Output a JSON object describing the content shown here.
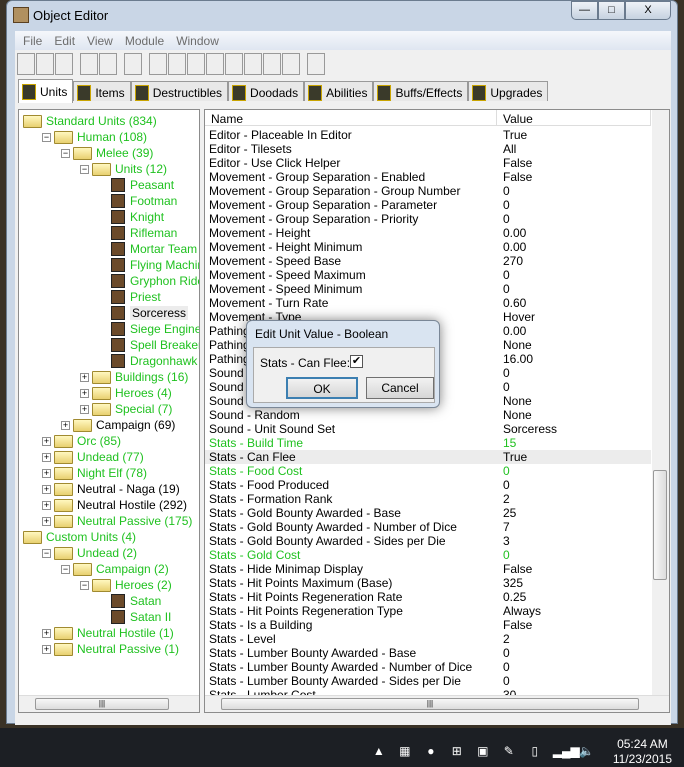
{
  "window": {
    "title": "Object Editor",
    "min": "—",
    "max": "□",
    "close": "X"
  },
  "menu": [
    "File",
    "Edit",
    "View",
    "Module",
    "Window"
  ],
  "toolbar": [
    "new",
    "open",
    "save",
    "copy",
    "paste",
    "unit",
    "terrain",
    "text",
    "sound",
    "unit-editor",
    "item",
    "destructible",
    "doodad",
    "import",
    "checklist"
  ],
  "tabs": [
    {
      "label": "Units",
      "active": true
    },
    {
      "label": "Items"
    },
    {
      "label": "Destructibles"
    },
    {
      "label": "Doodads"
    },
    {
      "label": "Abilities"
    },
    {
      "label": "Buffs/Effects"
    },
    {
      "label": "Upgrades"
    }
  ],
  "tree": [
    {
      "label": "Standard Units (834)",
      "level": 0,
      "type": "folder-open",
      "exp": ""
    },
    {
      "label": "Human (108)",
      "level": 1,
      "type": "folder-open",
      "exp": "-"
    },
    {
      "label": "Melee (39)",
      "level": 2,
      "type": "folder-open",
      "exp": "-"
    },
    {
      "label": "Units (12)",
      "level": 3,
      "type": "folder-open",
      "exp": "-"
    },
    {
      "label": "Peasant",
      "level": 4,
      "type": "unit"
    },
    {
      "label": "Footman",
      "level": 4,
      "type": "unit"
    },
    {
      "label": "Knight",
      "level": 4,
      "type": "unit"
    },
    {
      "label": "Rifleman",
      "level": 4,
      "type": "unit"
    },
    {
      "label": "Mortar Team",
      "level": 4,
      "type": "unit"
    },
    {
      "label": "Flying Machine",
      "level": 4,
      "type": "unit"
    },
    {
      "label": "Gryphon Rider",
      "level": 4,
      "type": "unit"
    },
    {
      "label": "Priest",
      "level": 4,
      "type": "unit"
    },
    {
      "label": "Sorceress",
      "level": 4,
      "type": "unit",
      "selected": true
    },
    {
      "label": "Siege Engine",
      "level": 4,
      "type": "unit"
    },
    {
      "label": "Spell Breaker",
      "level": 4,
      "type": "unit"
    },
    {
      "label": "Dragonhawk Rider",
      "level": 4,
      "type": "unit"
    },
    {
      "label": "Buildings (16)",
      "level": 3,
      "type": "folder",
      "exp": "+"
    },
    {
      "label": "Heroes (4)",
      "level": 3,
      "type": "folder",
      "exp": "+"
    },
    {
      "label": "Special (7)",
      "level": 3,
      "type": "folder",
      "exp": "+"
    },
    {
      "label": "Campaign (69)",
      "level": 2,
      "type": "folder",
      "exp": "+",
      "black": true
    },
    {
      "label": "Orc (85)",
      "level": 1,
      "type": "folder",
      "exp": "+"
    },
    {
      "label": "Undead (77)",
      "level": 1,
      "type": "folder",
      "exp": "+"
    },
    {
      "label": "Night Elf (78)",
      "level": 1,
      "type": "folder",
      "exp": "+"
    },
    {
      "label": "Neutral - Naga (19)",
      "level": 1,
      "type": "folder",
      "exp": "+",
      "black": true
    },
    {
      "label": "Neutral Hostile (292)",
      "level": 1,
      "type": "folder",
      "exp": "+",
      "black": true
    },
    {
      "label": "Neutral Passive (175)",
      "level": 1,
      "type": "folder",
      "exp": "+"
    },
    {
      "label": "Custom Units (4)",
      "level": 0,
      "type": "folder-open",
      "exp": ""
    },
    {
      "label": "Undead (2)",
      "level": 1,
      "type": "folder-open",
      "exp": "-"
    },
    {
      "label": "Campaign (2)",
      "level": 2,
      "type": "folder-open",
      "exp": "-"
    },
    {
      "label": "Heroes (2)",
      "level": 3,
      "type": "folder-open",
      "exp": "-"
    },
    {
      "label": "Satan",
      "level": 4,
      "type": "unit"
    },
    {
      "label": "Satan II",
      "level": 4,
      "type": "unit"
    },
    {
      "label": "Neutral Hostile (1)",
      "level": 1,
      "type": "folder",
      "exp": "+"
    },
    {
      "label": "Neutral Passive (1)",
      "level": 1,
      "type": "folder",
      "exp": "+"
    }
  ],
  "table": {
    "headers": [
      "Name",
      "Value"
    ],
    "rows": [
      [
        "Editor - Placeable In Editor",
        "True"
      ],
      [
        "Editor - Tilesets",
        "All"
      ],
      [
        "Editor - Use Click Helper",
        "False"
      ],
      [
        "Movement - Group Separation - Enabled",
        "False"
      ],
      [
        "Movement - Group Separation - Group Number",
        "0"
      ],
      [
        "Movement - Group Separation - Parameter",
        "0"
      ],
      [
        "Movement - Group Separation - Priority",
        "0"
      ],
      [
        "Movement - Height",
        "0.00"
      ],
      [
        "Movement - Height Minimum",
        "0.00"
      ],
      [
        "Movement - Speed Base",
        "270"
      ],
      [
        "Movement - Speed Maximum",
        "0"
      ],
      [
        "Movement - Speed Minimum",
        "0"
      ],
      [
        "Movement - Turn Rate",
        "0.60"
      ],
      [
        "Movement - Type",
        "Hover"
      ],
      [
        "Pathing",
        "0.00"
      ],
      [
        "Pathing",
        "None"
      ],
      [
        "Pathing",
        "16.00"
      ],
      [
        "Sound -",
        "0"
      ],
      [
        "Sound -",
        "0"
      ],
      [
        "Sound -",
        "None"
      ],
      [
        "Sound - Random",
        "None"
      ],
      [
        "Sound - Unit Sound Set",
        "Sorceress"
      ],
      [
        "Stats - Build Time",
        "15",
        "g"
      ],
      [
        "Stats - Can Flee",
        "True",
        "hl"
      ],
      [
        "Stats - Food Cost",
        "0",
        "g"
      ],
      [
        "Stats - Food Produced",
        "0"
      ],
      [
        "Stats - Formation Rank",
        "2"
      ],
      [
        "Stats - Gold Bounty Awarded - Base",
        "25"
      ],
      [
        "Stats - Gold Bounty Awarded - Number of Dice",
        "7"
      ],
      [
        "Stats - Gold Bounty Awarded - Sides per Die",
        "3"
      ],
      [
        "Stats - Gold Cost",
        "0",
        "g"
      ],
      [
        "Stats - Hide Minimap Display",
        "False"
      ],
      [
        "Stats - Hit Points Maximum (Base)",
        "325"
      ],
      [
        "Stats - Hit Points Regeneration Rate",
        "0.25"
      ],
      [
        "Stats - Hit Points Regeneration Type",
        "Always"
      ],
      [
        "Stats - Is a Building",
        "False"
      ],
      [
        "Stats - Level",
        "2"
      ],
      [
        "Stats - Lumber Bounty Awarded - Base",
        "0"
      ],
      [
        "Stats - Lumber Bounty Awarded - Number of Dice",
        "0"
      ],
      [
        "Stats - Lumber Bounty Awarded - Sides per Die",
        "0"
      ],
      [
        "Stats - Lumber Cost",
        "30"
      ]
    ]
  },
  "dialog": {
    "title": "Edit Unit Value - Boolean",
    "label": "Stats - Can Flee:",
    "checked": true,
    "ok": "OK",
    "cancel": "Cancel"
  },
  "taskbar": {
    "time": "05:24 AM",
    "date": "11/23/2015",
    "tray_icons": [
      "show-hidden-icon",
      "battery-meter-icon",
      "skype-icon",
      "windows-icon",
      "avg-icon",
      "feather-icon",
      "power-icon",
      "signal-icon",
      "volume-icon"
    ]
  },
  "colors": {
    "modified_green": "#1fc11f"
  }
}
